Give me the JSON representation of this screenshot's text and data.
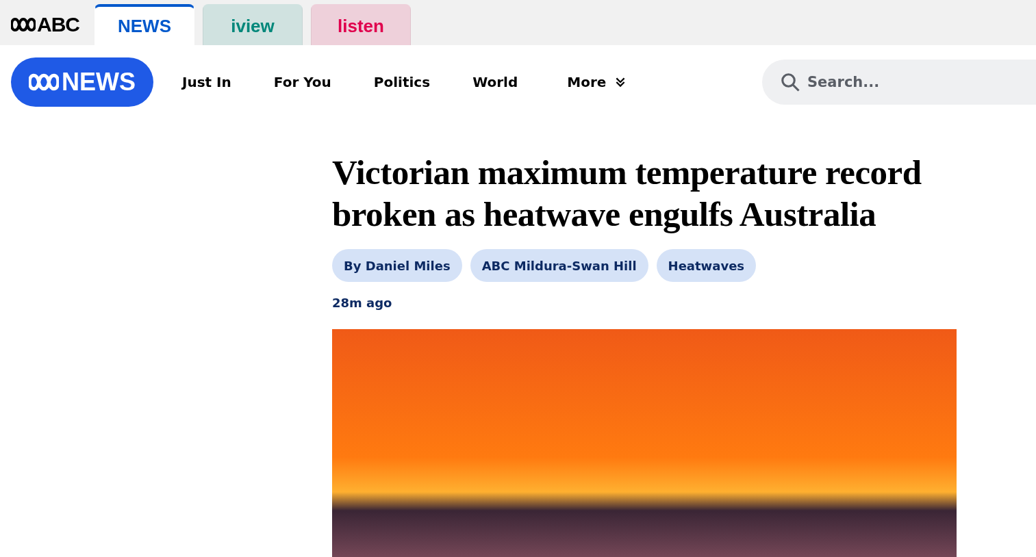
{
  "brand": {
    "logo_text": "ABC"
  },
  "site_tabs": [
    {
      "label": "NEWS",
      "selected": true,
      "color": "#0058cc"
    },
    {
      "label": "iview",
      "selected": false,
      "color": "#00877a"
    },
    {
      "label": "listen",
      "selected": false,
      "color": "#e0004d"
    }
  ],
  "header": {
    "logo_text": "NEWS",
    "nav": [
      {
        "label": "Just In",
        "kind": "link"
      },
      {
        "label": "For You",
        "kind": "link"
      },
      {
        "label": "Politics",
        "kind": "link"
      },
      {
        "label": "World",
        "kind": "link"
      },
      {
        "label": "More",
        "kind": "menu"
      }
    ],
    "search": {
      "placeholder": "Search..."
    }
  },
  "article": {
    "headline": "Victorian maximum temperature record broken as heatwave engulfs Australia",
    "tags": [
      "By Daniel Miles",
      "ABC Mildura-Swan Hill",
      "Heatwaves"
    ],
    "time": "28m ago"
  }
}
